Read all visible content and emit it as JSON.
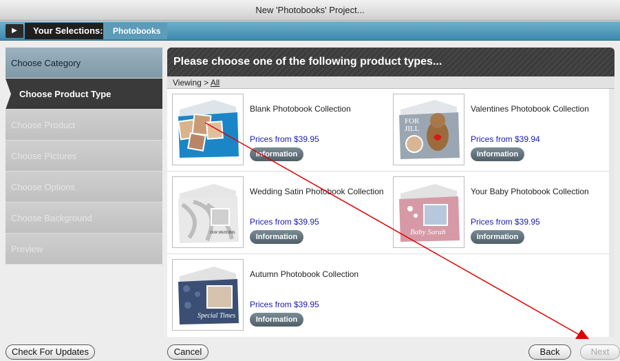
{
  "window": {
    "title": "New 'Photobooks' Project..."
  },
  "crumbs": {
    "main": "Your Selections:",
    "sub": "Photobooks"
  },
  "sidebar": {
    "items": [
      {
        "label": "Choose Category",
        "state": "done"
      },
      {
        "label": "Choose Product Type",
        "state": "active"
      },
      {
        "label": "Choose Product",
        "state": "disabled"
      },
      {
        "label": "Choose Pictures",
        "state": "disabled"
      },
      {
        "label": "Choose Options",
        "state": "disabled"
      },
      {
        "label": "Choose Background",
        "state": "disabled"
      },
      {
        "label": "Preview",
        "state": "disabled"
      }
    ]
  },
  "main": {
    "header": "Please choose one of the following product types...",
    "viewing_prefix": "Viewing >",
    "viewing_link": "All",
    "products": [
      {
        "title": "Blank Photobook Collection",
        "price": "Prices from $39.95",
        "button": "Information"
      },
      {
        "title": "Valentines Photobook Collection",
        "price": "Prices from $39.94",
        "button": "Information",
        "thumb_text": "FOR JILL"
      },
      {
        "title": "Wedding Satin Photobook Collection",
        "price": "Prices from $39.95",
        "button": "Information",
        "thumb_text": "OUR WEDDING"
      },
      {
        "title": "Your Baby Photobook Collection",
        "price": "Prices from $39.95",
        "button": "Information",
        "thumb_text": "Baby Sarah"
      },
      {
        "title": "Autumn Photobook Collection",
        "price": "Prices from $39.95",
        "button": "Information",
        "thumb_text": "Special Times"
      }
    ]
  },
  "footer": {
    "check_updates": "Check For Updates",
    "cancel": "Cancel",
    "back": "Back",
    "next": "Next"
  },
  "colors": {
    "accent": "#3d89ad",
    "annotation": "#e00000",
    "price": "#1a1ab0"
  }
}
